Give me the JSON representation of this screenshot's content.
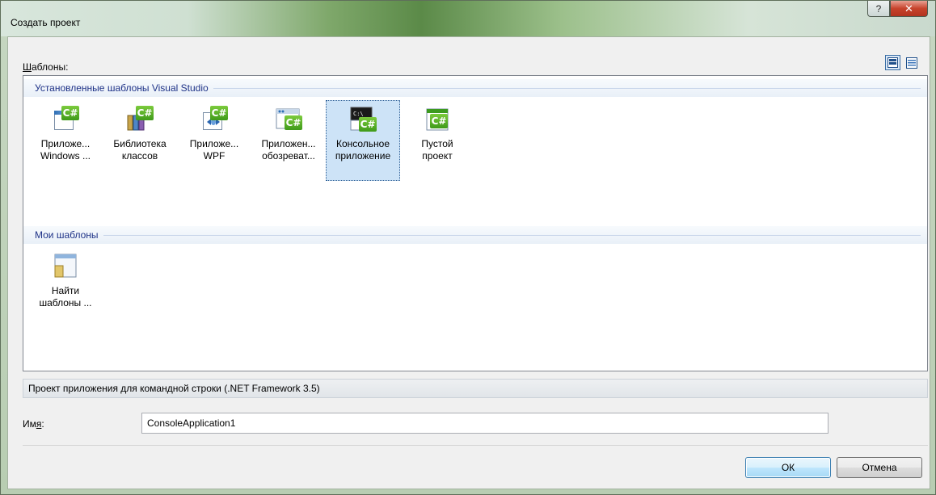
{
  "window": {
    "title": "Создать проект",
    "help_glyph": "?",
    "close_glyph": "✕"
  },
  "templates_label_prefix": "Ш",
  "templates_label_rest": "аблоны:",
  "groups": [
    {
      "title": "Установленные шаблоны Visual Studio",
      "items": [
        {
          "label": "Приложе...\nWindows ...",
          "icon": "windows-forms-app-icon"
        },
        {
          "label": "Библиотека\nклассов",
          "icon": "class-library-icon"
        },
        {
          "label": "Приложе...\nWPF",
          "icon": "wpf-app-icon"
        },
        {
          "label": "Приложен...\nобозреват...",
          "icon": "browser-app-icon"
        },
        {
          "label": "Консольное\nприложение",
          "icon": "console-app-icon",
          "selected": true
        },
        {
          "label": "Пустой\nпроект",
          "icon": "empty-project-icon"
        }
      ]
    },
    {
      "title": "Мои шаблоны",
      "items": [
        {
          "label": "Найти\nшаблоны ...",
          "icon": "search-templates-icon"
        }
      ]
    }
  ],
  "description": "Проект приложения для командной строки (.NET Framework 3.5)",
  "name_label_prefix": "Им",
  "name_label_underlined": "я",
  "name_label_suffix": ":",
  "name_value": "ConsoleApplication1",
  "ok_label": "ОК",
  "cancel_label": "Отмена",
  "colors": {
    "group_title": "#1e3287",
    "selection": "#cde3f7",
    "csharp_badge": "#4caf26"
  }
}
